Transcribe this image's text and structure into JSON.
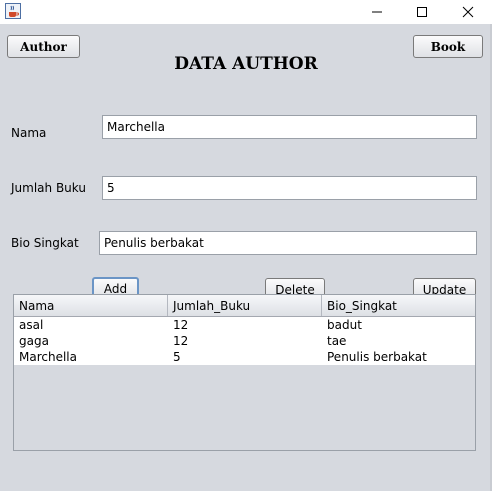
{
  "window": {
    "icon": "java-coffee-icon",
    "controls": {
      "minimize": "─",
      "maximize": "☐",
      "close": "✕"
    }
  },
  "toolbar": {
    "author_button": "Author",
    "book_button": "Book"
  },
  "form": {
    "title": "DATA AUTHOR",
    "nama_label": "Nama",
    "nama_value": "Marchella",
    "jumlah_label": "Jumlah Buku",
    "jumlah_value": "5",
    "bio_label": "Bio Singkat",
    "bio_value": "Penulis berbakat"
  },
  "actions": {
    "add": "Add",
    "delete": "Delete",
    "update": "Update"
  },
  "table": {
    "columns": [
      "Nama",
      "Jumlah_Buku",
      "Bio_Singkat"
    ],
    "rows": [
      [
        "asal",
        "12",
        "badut"
      ],
      [
        "gaga",
        "12",
        "tae"
      ],
      [
        "Marchella",
        "5",
        "Penulis berbakat"
      ]
    ]
  }
}
